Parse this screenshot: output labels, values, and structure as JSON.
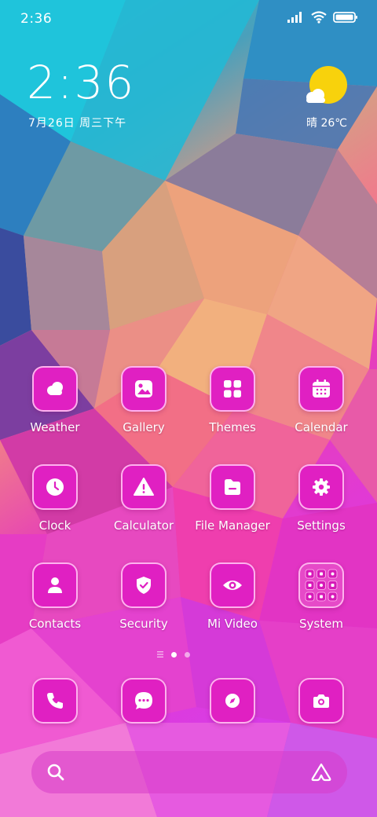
{
  "status_bar": {
    "time": "2:36",
    "icons": [
      "signal-icon",
      "wifi-icon",
      "battery-icon"
    ]
  },
  "clock_widget": {
    "time": "2:36",
    "date": "7月26日 周三下午"
  },
  "weather_widget": {
    "icon": "sun-cloud-icon",
    "summary": "晴 26℃"
  },
  "apps": [
    {
      "label": "Weather",
      "icon": "weather-icon"
    },
    {
      "label": "Gallery",
      "icon": "gallery-icon"
    },
    {
      "label": "Themes",
      "icon": "themes-icon"
    },
    {
      "label": "Calendar",
      "icon": "calendar-icon"
    },
    {
      "label": "Clock",
      "icon": "clock-icon"
    },
    {
      "label": "Calculator",
      "icon": "calculator-icon"
    },
    {
      "label": "File Manager",
      "icon": "folder-icon"
    },
    {
      "label": "Settings",
      "icon": "gear-icon"
    },
    {
      "label": "Contacts",
      "icon": "contacts-icon"
    },
    {
      "label": "Security",
      "icon": "shield-icon"
    },
    {
      "label": "Mi Video",
      "icon": "eye-icon"
    },
    {
      "label": "System",
      "icon": "folder-grid-icon"
    }
  ],
  "page_indicator": {
    "pages": 2,
    "active_page": 1
  },
  "dock": [
    {
      "icon": "phone-icon"
    },
    {
      "icon": "message-icon"
    },
    {
      "icon": "compass-icon"
    },
    {
      "icon": "camera-icon"
    }
  ],
  "search_bar": {
    "left_icon": "search-icon",
    "right_icon": "assistant-icon"
  },
  "colors": {
    "icon_fill": "#e020c2",
    "icon_border": "#ffb9f0",
    "text": "#ffffff"
  }
}
